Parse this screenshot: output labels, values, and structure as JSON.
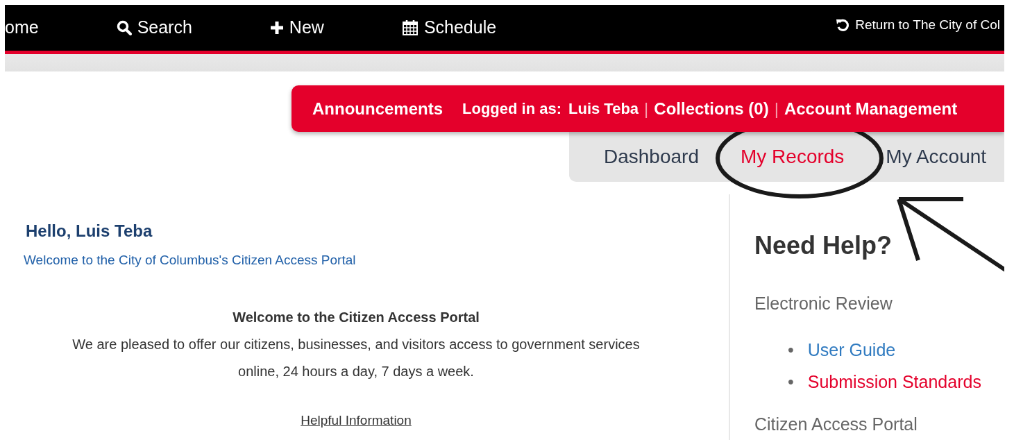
{
  "top_nav": {
    "items": [
      {
        "kind": "home",
        "label": "ome"
      },
      {
        "kind": "search",
        "label": "Search"
      },
      {
        "kind": "new",
        "label": "New"
      },
      {
        "kind": "schedule",
        "label": "Schedule"
      }
    ],
    "return_link": "Return to The City of Col"
  },
  "account_bar": {
    "announcements": "Announcements",
    "logged_in_label": "Logged in as:",
    "user_name": "Luis Teba",
    "separators": [
      "|",
      "|"
    ],
    "collections": "Collections (0)",
    "account_management": "Account Management"
  },
  "tabs": [
    {
      "label": "Dashboard",
      "selected": false
    },
    {
      "label": "My Records",
      "selected": true
    },
    {
      "label": "My Account",
      "selected": false
    }
  ],
  "greeting": {
    "title": "Hello, Luis Teba",
    "subtitle": "Welcome to the City of Columbus's Citizen Access Portal"
  },
  "welcome": {
    "heading": "Welcome to the Citizen Access Portal",
    "body": "We are pleased to offer our citizens, businesses, and visitors access to government services online, 24 hours a day, 7 days a week.",
    "helpful_link": "Helpful Information"
  },
  "help": {
    "title": "Need Help?",
    "sections": [
      {
        "title": "Electronic Review",
        "links": [
          {
            "marker": "•",
            "label": "User Guide",
            "color": "#2f7ac0"
          },
          {
            "marker": "•",
            "label": "Submission Standards",
            "color": "#e4002b"
          }
        ]
      },
      {
        "title": "Citizen Access Portal"
      }
    ]
  }
}
